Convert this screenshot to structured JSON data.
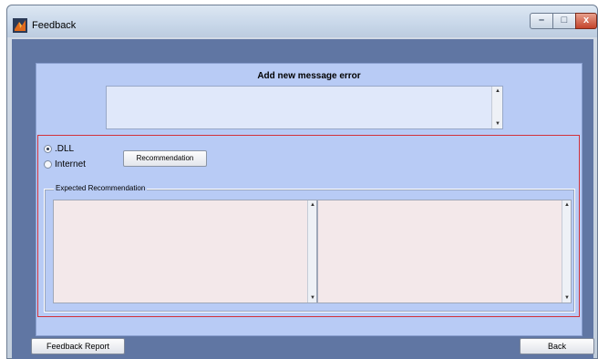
{
  "window": {
    "title": "Feedback",
    "controls": {
      "minimize": "–",
      "maximize": "□",
      "close": "x"
    }
  },
  "panel": {
    "heading": "Add new message error",
    "message_value": ""
  },
  "options": {
    "items": [
      {
        "label": ".DLL",
        "checked": true
      },
      {
        "label": "Internet",
        "checked": false
      }
    ],
    "recommendation_button": "Recommendation"
  },
  "expected": {
    "legend": "Expected Recommendation",
    "left_value": "",
    "right_value": ""
  },
  "footer": {
    "report_button": "Feedback Report",
    "back_button": "Back"
  },
  "colors": {
    "client_bg": "#6076a3",
    "panel_bg": "#b8cbf5",
    "highlight_frame": "#d1323a",
    "textbox_bg": "#f3e8ea"
  }
}
